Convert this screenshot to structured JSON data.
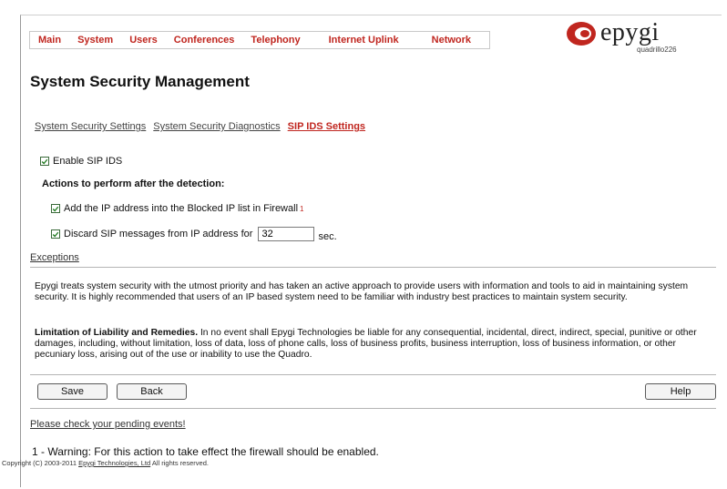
{
  "menu": {
    "items": [
      "Main",
      "System",
      "Users",
      "Conferences",
      "Telephony",
      "Internet Uplink",
      "Network"
    ]
  },
  "logo": {
    "word": "epygi",
    "sub": "quadrillo226",
    "color": "#c0261f"
  },
  "page": {
    "title": "System Security Management"
  },
  "tabs": [
    {
      "label": "System Security Settings",
      "active": false
    },
    {
      "label": "System Security Diagnostics",
      "active": false
    },
    {
      "label": "SIP IDS Settings",
      "active": true
    }
  ],
  "form": {
    "enable_label": "Enable SIP IDS",
    "enable_checked": true,
    "actions_heading": "Actions to perform after the detection:",
    "block_label": "Add the IP address into the Blocked IP list in Firewall",
    "block_footnote": "1",
    "block_checked": true,
    "discard_label": "Discard SIP messages from IP address for",
    "discard_checked": true,
    "discard_value": "32",
    "discard_unit": "sec."
  },
  "exceptions_link": "Exceptions",
  "paragraphs": {
    "security": "Epygi treats system security with the utmost priority and has taken an active approach to provide users with information and tools to aid in maintaining system security. It is highly recommended that users of an IP based system need to be familiar with industry best practices to maintain system security.",
    "liability_title": "Limitation of Liability and Remedies.",
    "liability_body": " In no event shall Epygi Technologies be liable for any consequential, incidental, direct, indirect, special, punitive or other damages, including, without limitation, loss of data, loss of phone calls, loss of business profits, business interruption, loss of business information, or other pecuniary loss, arising out of the use or inability to use the Quadro."
  },
  "buttons": {
    "save": "Save",
    "back": "Back",
    "help": "Help"
  },
  "pending_link": "Please check your pending events!",
  "warning": "1 - Warning: For this action to take effect the firewall should be enabled.",
  "copyright": {
    "prefix": "Copyright (C) 2003-2011 ",
    "company": "Epygi Technologies, Ltd",
    "suffix": " All rights reserved."
  }
}
